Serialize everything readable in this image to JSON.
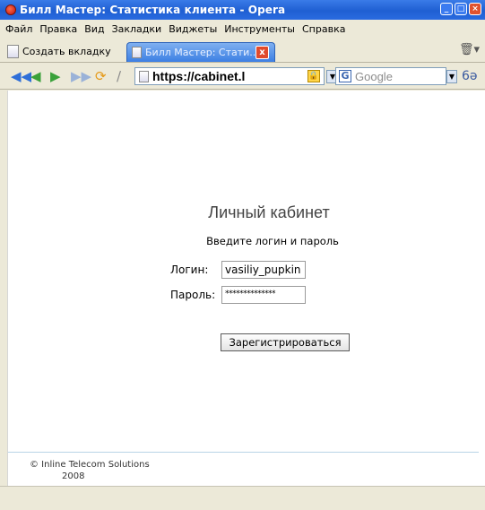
{
  "window": {
    "title": "Билл Мастер: Статистика клиента - Opera",
    "buttons": [
      "minimize",
      "maximize",
      "close"
    ]
  },
  "menu": {
    "items": [
      "Файл",
      "Правка",
      "Вид",
      "Закладки",
      "Виджеты",
      "Инструменты",
      "Справка"
    ]
  },
  "tabs": {
    "new_tab_label": "Создать вкладку",
    "active_tab_label": "Билл Мастер: Стати...",
    "close_label": "x"
  },
  "nav": {
    "address": "https://cabinet.l",
    "search_placeholder": "Google",
    "search_engine_letter": "G"
  },
  "page": {
    "heading": "Личный кабинет",
    "subheading": "Введите логин и пароль",
    "login_label": "Логин:",
    "login_value": "vasiliy_pupkin",
    "password_label": "Пароль:",
    "password_value": "**************",
    "submit_label": "Зарегистрироваться",
    "footer_company": "© Inline Telecom Solutions",
    "footer_year": "2008"
  },
  "colors": {
    "titlebar": "#1f5fd2",
    "active_tab": "#3c7fe3",
    "chrome": "#ece9d8"
  }
}
